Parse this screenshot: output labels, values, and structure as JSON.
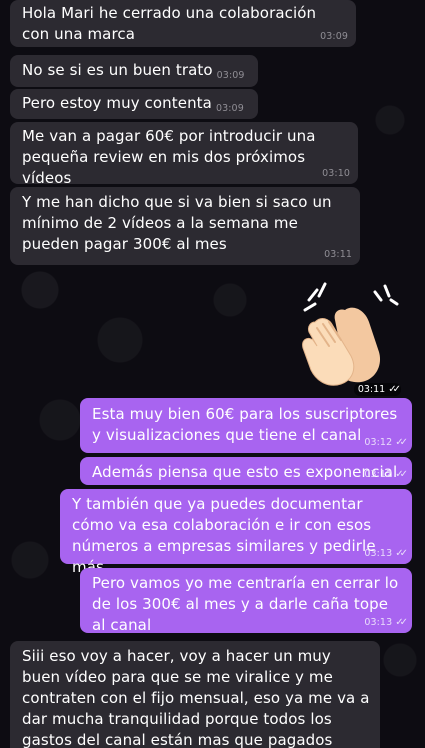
{
  "messages": [
    {
      "text": "Hola Mari he cerrado una colaboración con una marca",
      "time": "03:09"
    },
    {
      "text": "No se si es un buen trato",
      "time": "03:09"
    },
    {
      "text": "Pero estoy muy contenta",
      "time": "03:09"
    },
    {
      "text": "Me van a pagar 60€ por introducir una pequeña review en mis dos próximos vídeos",
      "time": "03:10"
    },
    {
      "text": "Y me han dicho que si va bien si saco un mínimo de 2 vídeos a la semana me pueden pagar 300€ al mes",
      "time": "03:11"
    },
    {
      "text": "👏",
      "time": "03:11",
      "type": "emoji"
    },
    {
      "text": "Esta muy bien 60€ para los suscriptores y visualizaciones que tiene el canal",
      "time": "03:12"
    },
    {
      "text": "Además piensa que esto es exponencial",
      "time": "03:12"
    },
    {
      "text": "Y también que ya puedes documentar cómo va esa colaboración e ir con esos números a empresas similares y pedirle más",
      "time": "03:13"
    },
    {
      "text": "Pero vamos yo me centraría en cerrar lo de los 300€ al mes y a darle caña tope al canal",
      "time": "03:13"
    },
    {
      "text": "Siii eso voy a hacer, voy a hacer un muy buen vídeo para que se me viralice y me contraten con el fijo mensual, eso ya me va a dar mucha tranquilidad porque todos los gastos del canal están mas que pagados"
    }
  ],
  "colors": {
    "incoming_bubble": "#2c2a31",
    "outgoing_bubble": "#a864f0",
    "background": "#0d0c12"
  },
  "icons": {
    "read_receipt": "double-check-icon",
    "sticker": "clapping-hands-icon"
  }
}
